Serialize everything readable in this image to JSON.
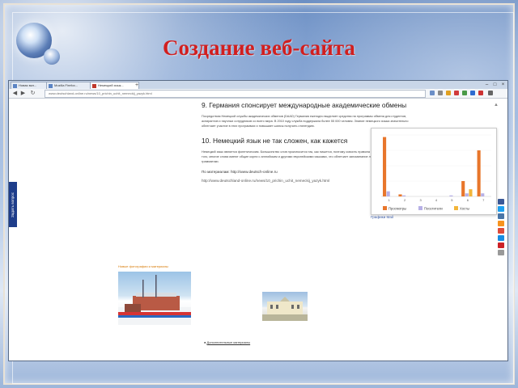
{
  "slide": {
    "title": "Создание веб-сайта"
  },
  "browser": {
    "tabs": [
      {
        "label": "Новая вкл..."
      },
      {
        "label": "Mozilla Firefox..."
      },
      {
        "label": "Немецкий язык..."
      }
    ],
    "new_tab_symbol": "+",
    "window_controls": [
      "–",
      "□",
      "×"
    ],
    "nav_symbols": [
      "◀",
      "▶",
      "↻"
    ],
    "url": "www.deutschland-online.ru/news/10_prichin_uchit_nemeckij_yazyk.html"
  },
  "sidebar": {
    "ask_question_label": "Задать вопрос"
  },
  "article": {
    "heading9": "9. Германия спонсирует международные академические обмены",
    "para9": "Посредством Немецкой службы академических обменов (DAAD) Германия ежегодно выделяет средства на программы обмена для студентов, аспирантов и научных сотрудников со всего мира. В 2010 году служба поддержала более 55 000 человек. Знание немецкого языка значительно облегчает участие в этих программах и повышает шансы получить стипендию.",
    "heading10": "10. Немецкий язык не так сложен, как кажется",
    "para10": "Немецкий язык является фонетическим. Большинство слов произносится так, как пишется, поэтому освоить правила чтения несложно. Кроме того, многие слова имеют общие корни с английским и другими европейскими языками, что облегчает запоминание лексики и изучение грамматики.",
    "source_label": "По материалам: http://www.deutsch-online.ru",
    "source_url": "http://www.deutschland-online.ru/news/10_prichin_uchit_nemeckij_yazyk.html"
  },
  "chart_caption": "Графики Mail",
  "chart_data": {
    "type": "bar",
    "title": "",
    "categories": [
      "1",
      "2",
      "3",
      "4",
      "5",
      "6",
      "7"
    ],
    "series": [
      {
        "name": "Просмотры",
        "color": "#e8762b",
        "values": [
          58,
          2,
          0,
          0,
          0,
          15,
          45
        ]
      },
      {
        "name": "Посетители",
        "color": "#b7b0e6",
        "values": [
          5,
          1,
          0,
          0,
          1,
          3,
          3
        ]
      },
      {
        "name": "Хосты",
        "color": "#f2b53a",
        "values": [
          0,
          0,
          0,
          0,
          0,
          7,
          0
        ]
      }
    ],
    "ylim": [
      0,
      60
    ]
  },
  "bottom": {
    "left_caption": "Новые фотографии и материалы",
    "link_label": "Дополнительные материалы"
  }
}
